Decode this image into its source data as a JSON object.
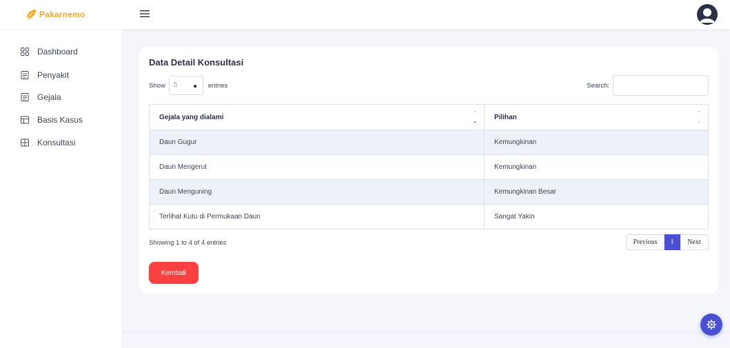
{
  "app": {
    "brand_name": "Pakarnemo",
    "brand_color": "#f9a825",
    "accent_color": "#4a4fd3",
    "danger_color": "#fb4041"
  },
  "sidebar": {
    "items": [
      {
        "label": "Dashboard",
        "icon": "grid-icon"
      },
      {
        "label": "Penyakit",
        "icon": "document-icon"
      },
      {
        "label": "Gejala",
        "icon": "document-icon"
      },
      {
        "label": "Basis Kasus",
        "icon": "table-icon"
      },
      {
        "label": "Konsultasi",
        "icon": "table-grid-icon"
      }
    ]
  },
  "card": {
    "title": "Data Detail Konsultasi",
    "length_menu": {
      "prefix": "Show",
      "value": "5",
      "suffix": "entries"
    },
    "search": {
      "label": "Search:",
      "value": ""
    },
    "table": {
      "headers": [
        "Gejala yang dialami",
        "Pilihan"
      ],
      "rows": [
        [
          "Daun Gugur",
          "Kemungkinan"
        ],
        [
          "Daun Mengerut",
          "Kemungkinan"
        ],
        [
          "Daun Menguning",
          "Kemungkinan Besar"
        ],
        [
          "Terlihat Kutu di Permukaan Daun",
          "Sangat Yakin"
        ]
      ]
    },
    "info": "Showing 1 to 4 of 4 entries",
    "pagination": {
      "previous": "Previous",
      "current": "1",
      "next": "Next"
    },
    "back_button": "Kembali"
  }
}
